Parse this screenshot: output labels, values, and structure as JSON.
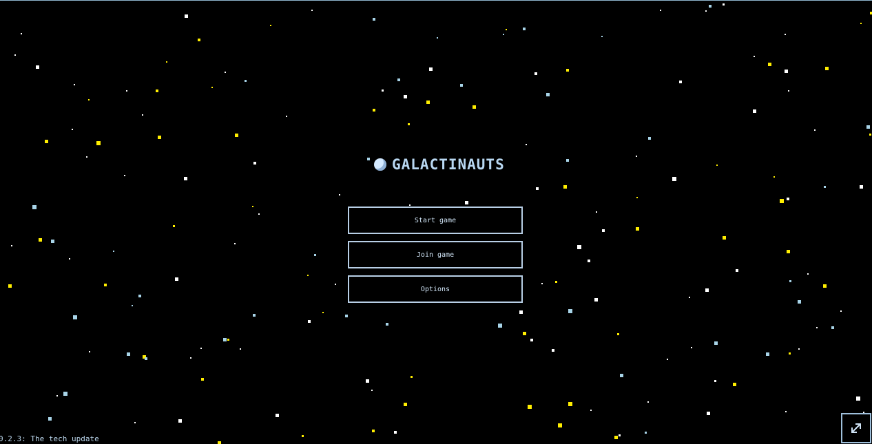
{
  "game": {
    "title": "GALACTINAUTS",
    "version_text": "0.2.3: The tech update"
  },
  "menu": {
    "start_label": "Start game",
    "join_label": "Join game",
    "options_label": "Options"
  },
  "icons": {
    "logo": "planet-icon",
    "fullscreen": "expand-arrows-icon"
  },
  "colors": {
    "background": "#000000",
    "accent": "#b9d8f2",
    "button_border": "#b8cfe6",
    "star_white": "#ffffff",
    "star_yellow": "#ffee00",
    "star_blue": "#a8d4e8"
  }
}
